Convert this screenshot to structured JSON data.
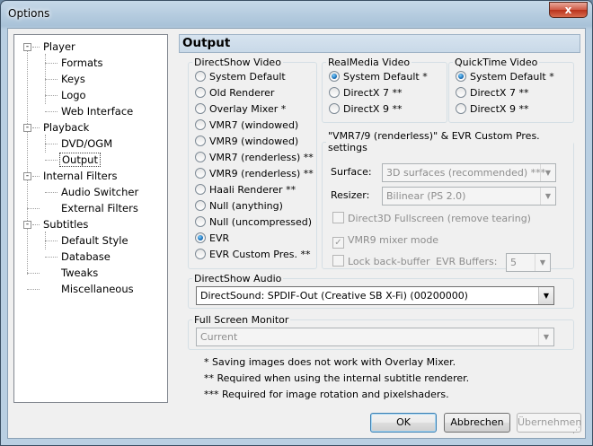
{
  "window": {
    "title": "Options",
    "close_glyph": "x"
  },
  "tree": {
    "items": [
      {
        "label": "Player",
        "expander": "-",
        "selected": false
      },
      {
        "label": "Formats",
        "selected": false
      },
      {
        "label": "Keys",
        "selected": false
      },
      {
        "label": "Logo",
        "selected": false
      },
      {
        "label": "Web Interface",
        "selected": false
      },
      {
        "label": "Playback",
        "expander": "-",
        "selected": false
      },
      {
        "label": "DVD/OGM",
        "selected": false
      },
      {
        "label": "Output",
        "selected": true
      },
      {
        "label": "Internal Filters",
        "expander": "-",
        "selected": false
      },
      {
        "label": "Audio Switcher",
        "selected": false
      },
      {
        "label": "External Filters",
        "selected": false
      },
      {
        "label": "Subtitles",
        "expander": "-",
        "selected": false
      },
      {
        "label": "Default Style",
        "selected": false
      },
      {
        "label": "Database",
        "selected": false
      },
      {
        "label": "Tweaks",
        "selected": false
      },
      {
        "label": "Miscellaneous",
        "selected": false
      }
    ]
  },
  "page": {
    "title": "Output"
  },
  "directshow_video": {
    "legend": "DirectShow Video",
    "options": [
      {
        "label": "System Default",
        "selected": false
      },
      {
        "label": "Old Renderer",
        "selected": false
      },
      {
        "label": "Overlay Mixer *",
        "selected": false
      },
      {
        "label": "VMR7 (windowed)",
        "selected": false
      },
      {
        "label": "VMR9 (windowed)",
        "selected": false
      },
      {
        "label": "VMR7 (renderless) **",
        "selected": false
      },
      {
        "label": "VMR9 (renderless) **",
        "selected": false
      },
      {
        "label": "Haali Renderer **",
        "selected": false
      },
      {
        "label": "Null (anything)",
        "selected": false
      },
      {
        "label": "Null (uncompressed)",
        "selected": false
      },
      {
        "label": "EVR",
        "selected": true
      },
      {
        "label": "EVR Custom Pres. **",
        "selected": false
      }
    ]
  },
  "realmedia_video": {
    "legend": "RealMedia Video",
    "options": [
      {
        "label": "System Default *",
        "selected": true
      },
      {
        "label": "DirectX 7 **",
        "selected": false
      },
      {
        "label": "DirectX 9 **",
        "selected": false
      }
    ]
  },
  "quicktime_video": {
    "legend": "QuickTime Video",
    "options": [
      {
        "label": "System Default *",
        "selected": true
      },
      {
        "label": "DirectX 7 **",
        "selected": false
      },
      {
        "label": "DirectX 9 **",
        "selected": false
      }
    ]
  },
  "custom_pres": {
    "legend": "\"VMR7/9 (renderless)\" & EVR Custom Pres. settings",
    "surface_label": "Surface:",
    "surface_value": "3D surfaces (recommended) ***",
    "resizer_label": "Resizer:",
    "resizer_value": "Bilinear (PS 2.0)",
    "d3d_fullscreen": {
      "label": "Direct3D Fullscreen (remove tearing)",
      "checked": false
    },
    "vmr9_mixer": {
      "label": "VMR9 mixer mode",
      "checked": true
    },
    "lock_back_buffer": {
      "label": "Lock back-buffer",
      "checked": false
    },
    "evr_buffers_label": "EVR Buffers:",
    "evr_buffers_value": "5"
  },
  "directshow_audio": {
    "legend": "DirectShow Audio",
    "value": "DirectSound: SPDIF-Out (Creative SB X-Fi) (00200000)"
  },
  "fullscreen_monitor": {
    "legend": "Full Screen Monitor",
    "value": "Current"
  },
  "notes": [
    "* Saving images does not work with Overlay Mixer.",
    "** Required when using the internal subtitle renderer.",
    "*** Required for image rotation and pixelshaders."
  ],
  "buttons": {
    "ok": "OK",
    "cancel": "Abbrechen",
    "apply": "Übernehmen"
  },
  "icons": {
    "radio_selected": "radio-on-icon",
    "checkbox_checked": "checkmark-icon",
    "dropdown": "chevron-down-icon"
  }
}
